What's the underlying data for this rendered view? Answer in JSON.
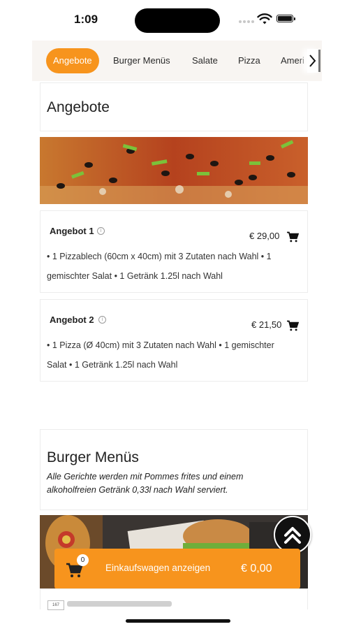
{
  "status_bar": {
    "time": "1:09"
  },
  "categories": [
    {
      "label": "Angebote",
      "active": true
    },
    {
      "label": "Burger Menüs",
      "active": false
    },
    {
      "label": "Salate",
      "active": false
    },
    {
      "label": "Pizza",
      "active": false
    },
    {
      "label": "Ameri",
      "active": false
    }
  ],
  "offers": {
    "heading": "Angebote",
    "items": [
      {
        "title": "Angebot 1",
        "price": "€ 29,00",
        "desc_line1": "• 1 Pizzablech (60cm x 40cm) mit 3 Zutaten nach Wahl • 1",
        "desc_line2": "gemischter Salat • 1 Getränk 1.25l nach Wahl"
      },
      {
        "title": "Angebot 2",
        "price": "€ 21,50",
        "desc_line1": "• 1 Pizza (Ø 40cm) mit 3 Zutaten nach Wahl • 1 gemischter",
        "desc_line2": "Salat • 1 Getränk 1.25l nach Wahl"
      }
    ]
  },
  "burger": {
    "heading": "Burger Menüs",
    "subtitle_line1": "Alle Gerichte werden mit Pommes frites und einem",
    "subtitle_line2": "alkoholfreien Getränk 0,33l nach Wahl serviert."
  },
  "cart": {
    "count": "0",
    "label": "Einkaufswagen anzeigen",
    "total": "€ 0,00"
  },
  "peek_item_number": "167",
  "colors": {
    "accent": "#f7941d",
    "dark": "#111111"
  },
  "icons": [
    "wifi-icon",
    "battery-icon",
    "chevron-right-icon",
    "info-icon",
    "cart-icon",
    "double-chevron-up-icon"
  ]
}
